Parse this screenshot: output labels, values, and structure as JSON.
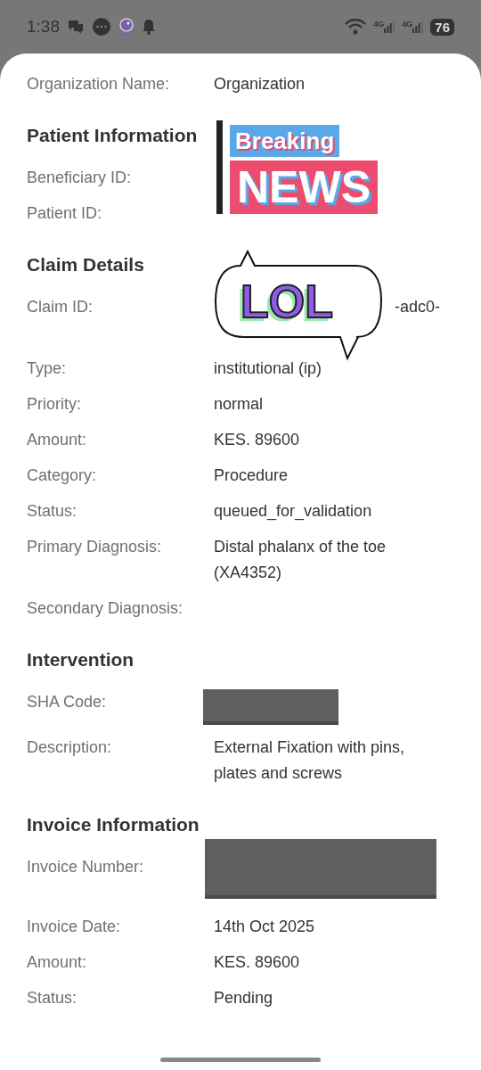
{
  "status_bar": {
    "time": "1:38",
    "network_labels": [
      "4G",
      "4G"
    ],
    "battery": "76"
  },
  "top_row": {
    "label": "Organization Name:",
    "value": "Organization"
  },
  "sections": [
    {
      "title": "Patient Information",
      "rows": [
        {
          "label": "Beneficiary ID:",
          "kind": "covered"
        },
        {
          "label": "Patient ID:",
          "kind": "covered"
        }
      ]
    },
    {
      "title": "Claim Details",
      "rows": [
        {
          "label": "Claim ID:",
          "kind": "partial",
          "value": "-adc0-"
        },
        {
          "label": "Type:",
          "kind": "text",
          "value": "institutional (ip)"
        },
        {
          "label": "Priority:",
          "kind": "text",
          "value": "normal"
        },
        {
          "label": "Amount:",
          "kind": "text",
          "value": "KES. 89600"
        },
        {
          "label": "Category:",
          "kind": "text",
          "value": "Procedure"
        },
        {
          "label": "Status:",
          "kind": "text",
          "value": "queued_for_validation"
        },
        {
          "label": "Primary Diagnosis:",
          "kind": "text",
          "value": "Distal phalanx of the toe (XA4352)"
        },
        {
          "label": "Secondary Diagnosis:",
          "kind": "empty"
        }
      ]
    },
    {
      "title": "Intervention",
      "rows": [
        {
          "label": "SHA Code:",
          "kind": "redacted"
        },
        {
          "label": "Description:",
          "kind": "text",
          "value": "External Fixation with pins, plates and screws"
        }
      ]
    },
    {
      "title": "Invoice Information",
      "rows": [
        {
          "label": "Invoice Number:",
          "kind": "redacted_large"
        },
        {
          "label": "Invoice Date:",
          "kind": "text",
          "value": "14th Oct 2025"
        },
        {
          "label": "Amount:",
          "kind": "text",
          "value": "KES. 89600"
        },
        {
          "label": "Status:",
          "kind": "text",
          "value": "Pending"
        }
      ]
    }
  ],
  "stickers": [
    {
      "kind": "news",
      "lines": [
        "Breaking",
        "NEWS"
      ]
    },
    {
      "kind": "bubble",
      "lines": [
        "LOL"
      ]
    }
  ]
}
